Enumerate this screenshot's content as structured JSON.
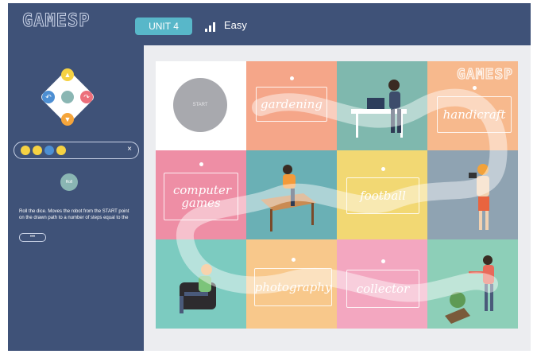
{
  "header": {
    "logo": "GAMESP",
    "unit_label": "UNIT 4",
    "difficulty_label": "Easy",
    "difficulty_icon": "signal-bars-icon"
  },
  "sidebar": {
    "dpad_icons": [
      "arrow-up-icon",
      "turn-left-icon",
      "center-icon",
      "turn-right-icon",
      "arrow-down-icon"
    ],
    "sequence_icons": [
      "yellow-command-icon",
      "yellow-command-icon",
      "blue-command-icon",
      "yellow-command-icon"
    ],
    "clear_label": "×",
    "roll_label": "Roll",
    "instructions": "Roll the dice. Moves the robot from the START point on the drawn path to a number of steps equal to the",
    "more_label": "•••"
  },
  "board": {
    "start_label": "START",
    "logo": "GAMESP",
    "tiles": [
      {
        "label": "",
        "color": "#ffffff"
      },
      {
        "label": "gardening",
        "color": "#f5a689"
      },
      {
        "label": "",
        "color": "#7fb8ae"
      },
      {
        "label": "handicraft",
        "color": "#f7b98d"
      },
      {
        "label": "computer games",
        "color": "#ee8ea5"
      },
      {
        "label": "",
        "color": "#6ab0b5"
      },
      {
        "label": "football",
        "color": "#f2d873"
      },
      {
        "label": "",
        "color": "#8fa3b2"
      },
      {
        "label": "",
        "color": "#7ccbc0"
      },
      {
        "label": "photography",
        "color": "#f8c88b"
      },
      {
        "label": "collector",
        "color": "#f3a7c0"
      },
      {
        "label": "",
        "color": "#8dcfb8"
      }
    ]
  },
  "colors": {
    "navy": "#3f5278",
    "accent_teal": "#58b7c9",
    "panel_bg": "#ecedf0"
  }
}
